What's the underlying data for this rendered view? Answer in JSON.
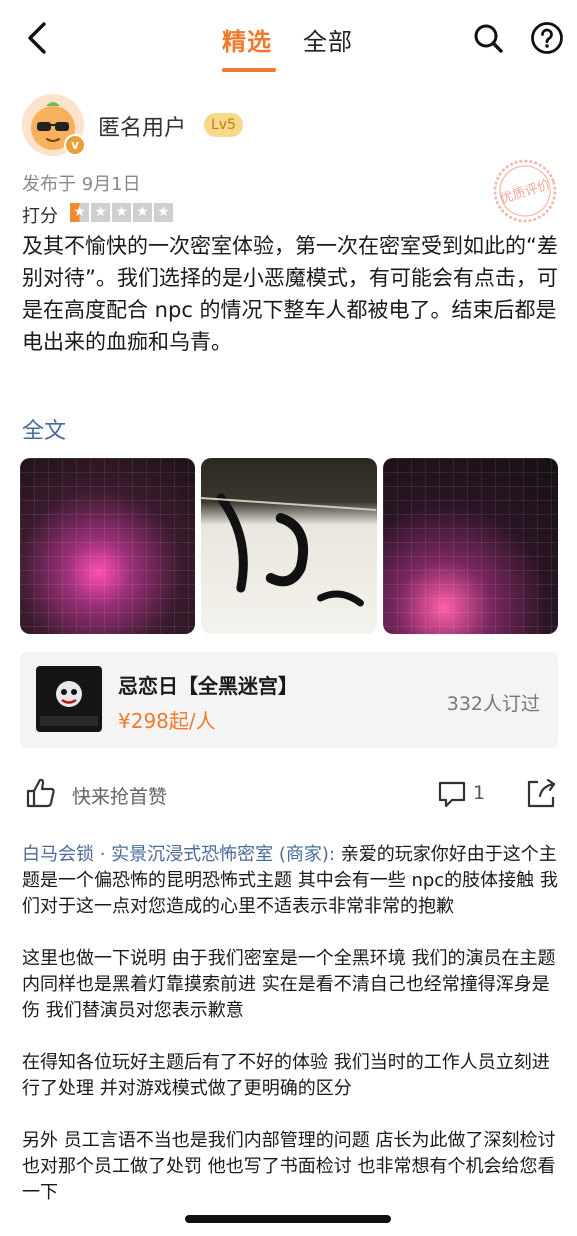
{
  "nav": {
    "tab_selected": "精选",
    "tab_all": "全部"
  },
  "user": {
    "name": "匿名用户",
    "level": "Lv5",
    "verified_badge": "v"
  },
  "review": {
    "date": "发布于 9月1日",
    "rating_label": "打分",
    "rating_stars": 0.5,
    "rating_max": 5,
    "quality_stamp": "优质评价",
    "text": "及其不愉快的一次密室体验，第一次在密室受到如此的“差别对待”。我们选择的是小恶魔模式，有可能会有点击，可是在高度配合 npc 的情况下整车人都被电了。结束后都是电出来的血痂和乌青。",
    "full_text_link": "全文"
  },
  "product": {
    "title": "忌恋日【全黑迷宫】",
    "price": "¥298起/人",
    "booked": "332人订过"
  },
  "actions": {
    "like_text": "快来抢首赞",
    "comment_count": "1"
  },
  "reply": {
    "merchant": "白马会锁 · 实景沉浸式恐怖密室 (商家):",
    "p1": "亲爱的玩家你好由于这个主题是一个偏恐怖的昆明恐怖式主题 其中会有一些 npc的肢体接触 我们对于这一点对您造成的心里不适表示非常非常的抱歉",
    "p2": "这里也做一下说明 由于我们密室是一个全黑环境 我们的演员在主题内同样也是黑着灯靠摸索前进 实在是看不清自己也经常撞得浑身是伤 我们替演员对您表示歉意",
    "p3": "在得知各位玩好主题后有了不好的体验 我们当时的工作人员立刻进行了处理 并对游戏模式做了更明确的区分",
    "p4": "另外 员工言语不当也是我们内部管理的问题 店长为此做了深刻检讨 也对那个员工做了处罚 他也写了书面检讨 也非常想有个机会给您看一下"
  },
  "colors": {
    "accent": "#f07a2c",
    "link": "#4a6b9a"
  }
}
